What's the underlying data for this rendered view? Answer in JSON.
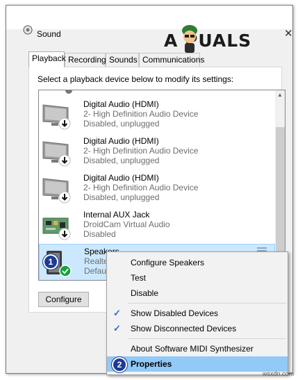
{
  "window": {
    "title": "Sound",
    "close_glyph": "✕"
  },
  "logo": {
    "text": "A  PUALS"
  },
  "tabs": [
    {
      "label": "Playback",
      "active": true
    },
    {
      "label": "Recording",
      "active": false
    },
    {
      "label": "Sounds",
      "active": false
    },
    {
      "label": "Communications",
      "active": false
    }
  ],
  "instruction": "Select a playback device below to modify its settings:",
  "devices": [
    {
      "name": "Digital Audio (HDMI)",
      "description": "2- High Definition Audio Device",
      "status": "Disabled, unplugged",
      "icon": "monitor-icon"
    },
    {
      "name": "Digital Audio (HDMI)",
      "description": "2- High Definition Audio Device",
      "status": "Disabled, unplugged",
      "icon": "monitor-icon"
    },
    {
      "name": "Digital Audio (HDMI)",
      "description": "2- High Definition Audio Device",
      "status": "Disabled, unplugged",
      "icon": "monitor-icon"
    },
    {
      "name": "Internal AUX Jack",
      "description": "DroidCam Virtual Audio",
      "status": "Disabled",
      "icon": "circuit-board-icon"
    },
    {
      "name": "Speakers",
      "description": "Realte",
      "status": "Defaul",
      "icon": "speaker-icon",
      "selected": true
    }
  ],
  "buttons": {
    "configure": "Configure"
  },
  "context_menu": {
    "items": [
      {
        "label": "Configure Speakers"
      },
      {
        "label": "Test"
      },
      {
        "label": "Disable"
      },
      {
        "label": "Show Disabled Devices",
        "checked": true
      },
      {
        "label": "Show Disconnected Devices",
        "checked": true
      },
      {
        "label": "About Software MIDI Synthesizer"
      },
      {
        "label": "Properties",
        "highlighted": true
      }
    ]
  },
  "steps": {
    "one": "1",
    "two": "2"
  },
  "watermark": "wsxdn.com",
  "colors": {
    "selection": "#cce8ff",
    "menu_highlight": "#91c9f7",
    "step_badge": "#1d3b93",
    "default_check": "#12a33b"
  }
}
